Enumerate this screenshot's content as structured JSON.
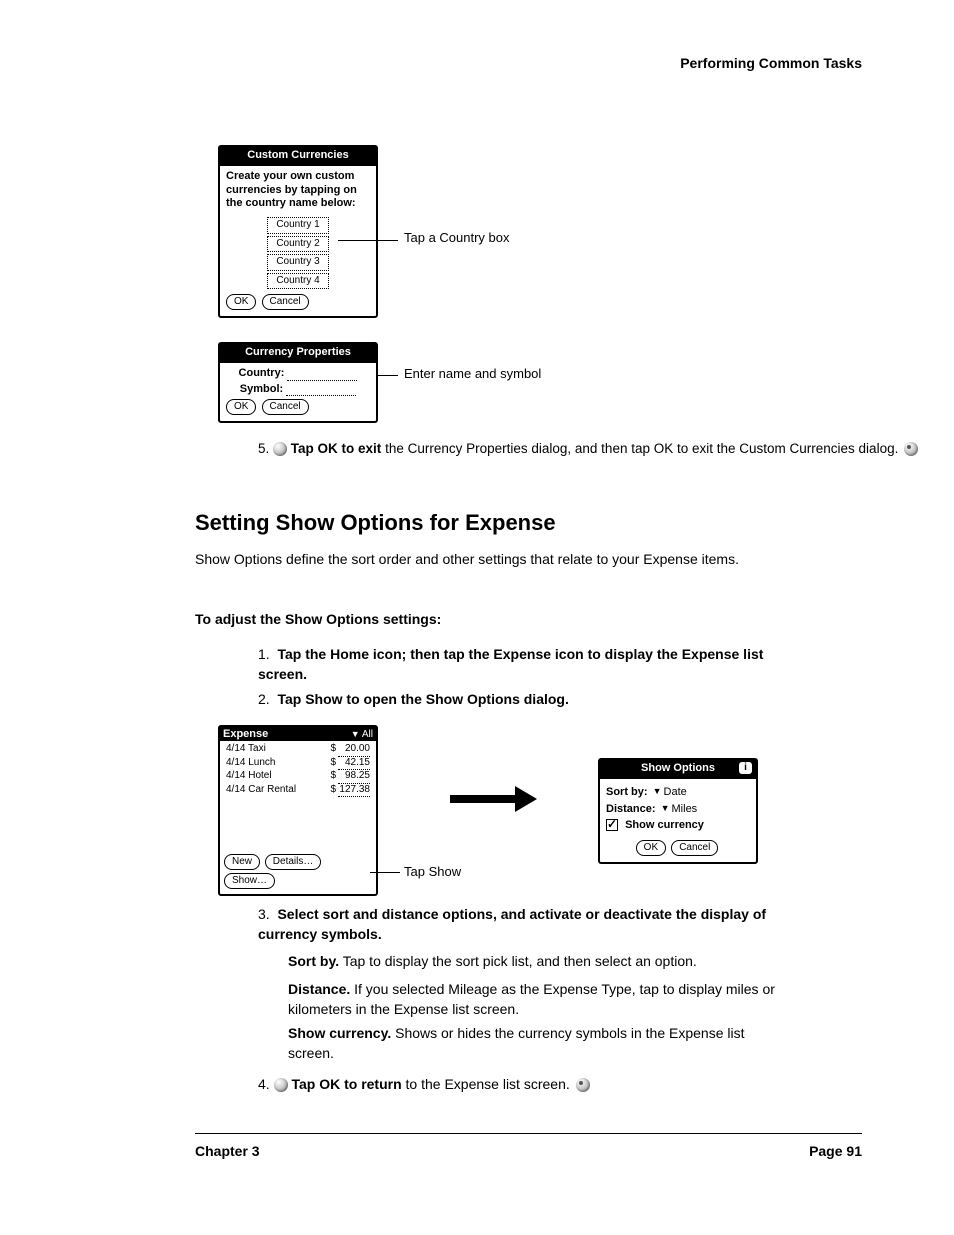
{
  "header_right": "Performing Common Tasks",
  "custom_currencies": {
    "title": "Custom Currencies",
    "instr": "Create your own custom currencies by tapping on the country name below:",
    "countries": [
      "Country 1",
      "Country 2",
      "Country 3",
      "Country 4"
    ],
    "ok": "OK",
    "cancel": "Cancel",
    "callout": "Tap a Country box"
  },
  "currency_props": {
    "title": "Currency Properties",
    "country_label": "Country:",
    "symbol_label": "Symbol:",
    "ok": "OK",
    "cancel": "Cancel",
    "callout": "Enter name and symbol"
  },
  "step5": {
    "num": "5.",
    "a": "Tap OK to exit",
    "b": " the Currency Properties dialog, and then tap OK to exit the Custom Currencies dialog."
  },
  "options_section": {
    "title": "Setting Show Options for Expense",
    "intro": "Show Options define the sort order and other settings that relate to your Expense items.",
    "lead": "To adjust the Show Options settings:",
    "steps": [
      "Tap the Home icon; then tap the Expense icon to display the Expense list screen.",
      "Tap Show to open the Show Options dialog."
    ]
  },
  "expense_app": {
    "title": "Expense",
    "filter": "All",
    "rows": [
      {
        "desc": "4/14 Taxi",
        "cur": "$",
        "val": "20.00"
      },
      {
        "desc": "4/14 Lunch",
        "cur": "$",
        "val": "42.15"
      },
      {
        "desc": "4/14 Hotel",
        "cur": "$",
        "val": "98.25"
      },
      {
        "desc": "4/14 Car Rental",
        "cur": "$",
        "val": "127.38"
      }
    ],
    "buttons": {
      "new": "New",
      "details": "Details…",
      "show": "Show…"
    },
    "callout": "Tap Show"
  },
  "show_options": {
    "title": "Show Options",
    "sort_label": "Sort by:",
    "sort_value": "Date",
    "dist_label": "Distance:",
    "dist_value": "Miles",
    "show_cur": "Show currency",
    "ok": "OK",
    "cancel": "Cancel"
  },
  "step3": {
    "num": "3.",
    "text": "Select sort and distance options, and activate or deactivate the display of currency symbols.",
    "sort_lead": "Sort by.",
    "sort_body": " Tap to display the sort pick list, and then select an option.",
    "dist_lead": "Distance.",
    "dist_body": " If you selected Mileage as the Expense Type, tap to display miles or kilometers in the Expense list screen.",
    "cur_lead": "Show currency.",
    "cur_body": " Shows or hides the currency symbols in the Expense list screen."
  },
  "step4": {
    "num": "4.",
    "a": "Tap OK to return",
    "b": " to the Expense list screen."
  },
  "footer": {
    "left": "Chapter 3",
    "right": "Page 91"
  }
}
